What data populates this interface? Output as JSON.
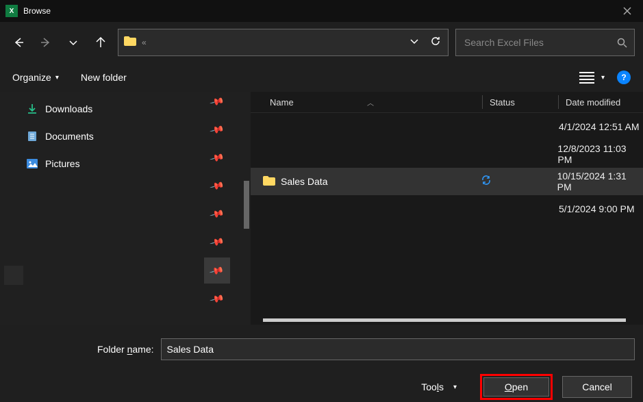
{
  "titlebar": {
    "title": "Browse"
  },
  "nav": {
    "chevrons": "«"
  },
  "search": {
    "placeholder": "Search Excel Files"
  },
  "toolbar": {
    "organize": "Organize",
    "new_folder": "New folder"
  },
  "sidebar": {
    "items": [
      {
        "label": "Downloads",
        "icon": "downloads"
      },
      {
        "label": "Documents",
        "icon": "documents"
      },
      {
        "label": "Pictures",
        "icon": "pictures"
      }
    ]
  },
  "columns": {
    "name": "Name",
    "status": "Status",
    "date": "Date modified"
  },
  "files": [
    {
      "name": "",
      "status": "",
      "date": "4/1/2024 12:51 AM"
    },
    {
      "name": "",
      "status": "",
      "date": "12/8/2023 11:03 PM"
    },
    {
      "name": "Sales Data",
      "status": "sync",
      "date": "10/15/2024 1:31 PM",
      "selected": true,
      "icon": "folder"
    },
    {
      "name": "",
      "status": "",
      "date": "5/1/2024 9:00 PM"
    }
  ],
  "bottom": {
    "name_label_pre": "Folder ",
    "name_label_u": "n",
    "name_label_post": "ame:",
    "input_value": "Sales Data",
    "tools_pre": "Too",
    "tools_u": "l",
    "tools_post": "s",
    "open_u": "O",
    "open_post": "pen",
    "cancel": "Cancel"
  }
}
